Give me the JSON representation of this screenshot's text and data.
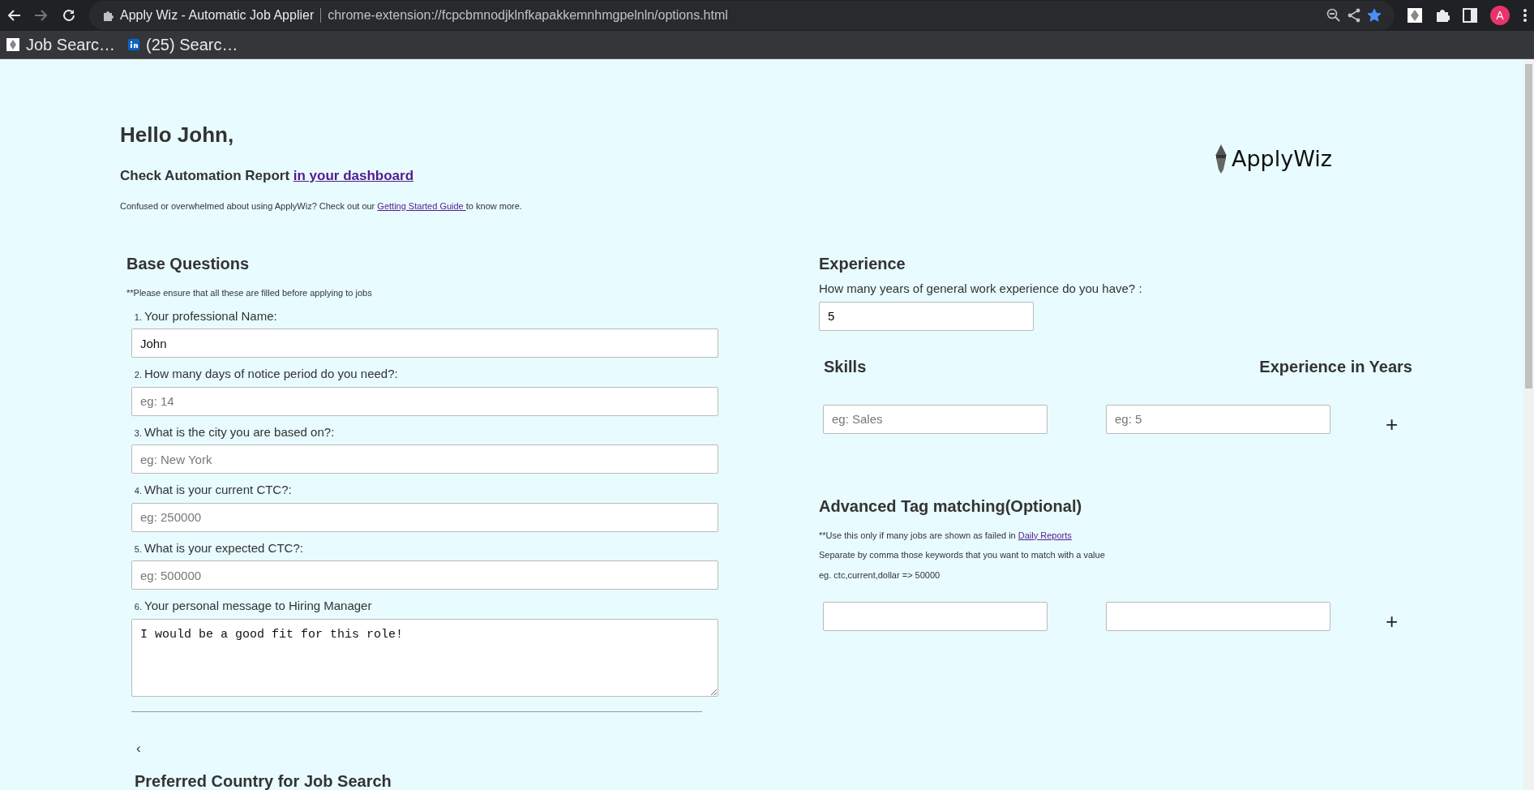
{
  "browser": {
    "back_enabled": true,
    "forward_enabled": false,
    "page_title": "Apply Wiz - Automatic Job Applier",
    "url": "chrome-extension://fcpcbmnodjklnfkapakkemnhmgpelnln/options.html",
    "bookmarked": true,
    "avatar": "A",
    "bookmarks": [
      {
        "label": "Job Searc…",
        "kind": "extension"
      },
      {
        "label": "(25) Searc…",
        "kind": "linkedin"
      }
    ]
  },
  "header": {
    "greeting": "Hello John,",
    "report_text": "Check Automation Report ",
    "report_link": "in your dashboard",
    "help_before": "Confused or overwhelmed about using ApplyWiz? Check out our ",
    "help_link": "Getting Started Guide ",
    "help_after": "to know more.",
    "logo_text": "ApplyWiz"
  },
  "base_questions": {
    "title": "Base Questions",
    "note": "**Please ensure that all these are filled before applying to jobs",
    "questions": [
      {
        "number": "1.",
        "label": "Your professional Name:",
        "kind": "input",
        "value": "John"
      },
      {
        "number": "2.",
        "label": "How many days of notice period do you need?:",
        "kind": "input",
        "placeholder": "eg: 14"
      },
      {
        "number": "3.",
        "label": "What is the city you are based on?:",
        "kind": "input",
        "placeholder": "eg: New York"
      },
      {
        "number": "4.",
        "label": "What is your current CTC?:",
        "kind": "input",
        "placeholder": "eg: 250000"
      },
      {
        "number": "5.",
        "label": "What is your expected CTC?:",
        "kind": "input",
        "placeholder": "eg: 500000"
      },
      {
        "number": "6.",
        "label": "Your personal message to Hiring Manager",
        "kind": "textarea",
        "value": "I would be a good fit for this role!"
      }
    ]
  },
  "back_button": "‹",
  "next_section_title": "Preferred Country for Job Search",
  "experience": {
    "title": "Experience",
    "question": "How many years of general work experience do you have? :",
    "value": "5"
  },
  "skills": {
    "column_1": "Skills",
    "column_2": "Experience in Years",
    "rows": [
      {
        "skill_placeholder": "eg: Sales",
        "years_placeholder": "eg: 5",
        "add_button": "+"
      }
    ]
  },
  "tag_matching": {
    "title": "Advanced Tag matching(Optional)",
    "note_before": "**Use this only if many jobs are shown as failed in ",
    "note_link": "Daily Reports",
    "separator_hint": "Separate by comma those keywords that you want to match with a value",
    "example": "eg. ctc,current,dollar => 50000",
    "rows": [
      {
        "add_button": "+"
      }
    ]
  }
}
